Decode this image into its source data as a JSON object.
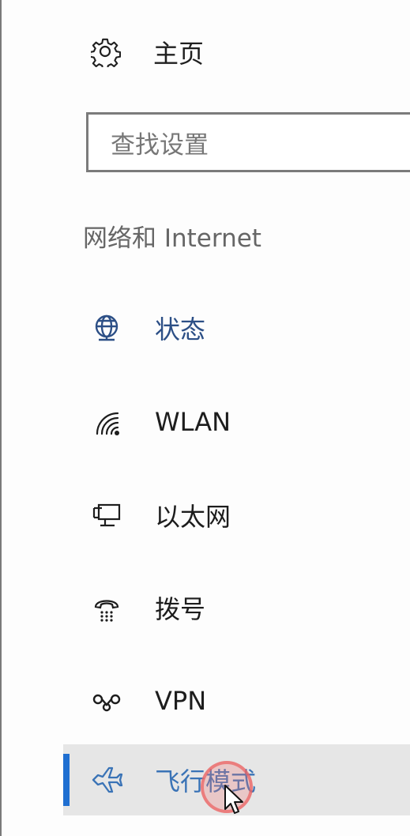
{
  "header": {
    "home_label": "主页",
    "home_icon": "gear-icon"
  },
  "search": {
    "placeholder": "查找设置"
  },
  "section": {
    "title": "网络和 Internet"
  },
  "nav": {
    "items": [
      {
        "label": "状态",
        "icon": "globe-monitor-icon"
      },
      {
        "label": "WLAN",
        "icon": "wifi-icon"
      },
      {
        "label": "以太网",
        "icon": "ethernet-icon"
      },
      {
        "label": "拨号",
        "icon": "dialup-phone-icon"
      },
      {
        "label": "VPN",
        "icon": "vpn-icon"
      },
      {
        "label": "飞行模式",
        "icon": "airplane-icon",
        "selected": true
      }
    ]
  },
  "colors": {
    "accent": "#1f6fd1",
    "selected_text": "#3a73b6",
    "status_text": "#2c4f86",
    "selected_bg": "#e6e6e6"
  }
}
